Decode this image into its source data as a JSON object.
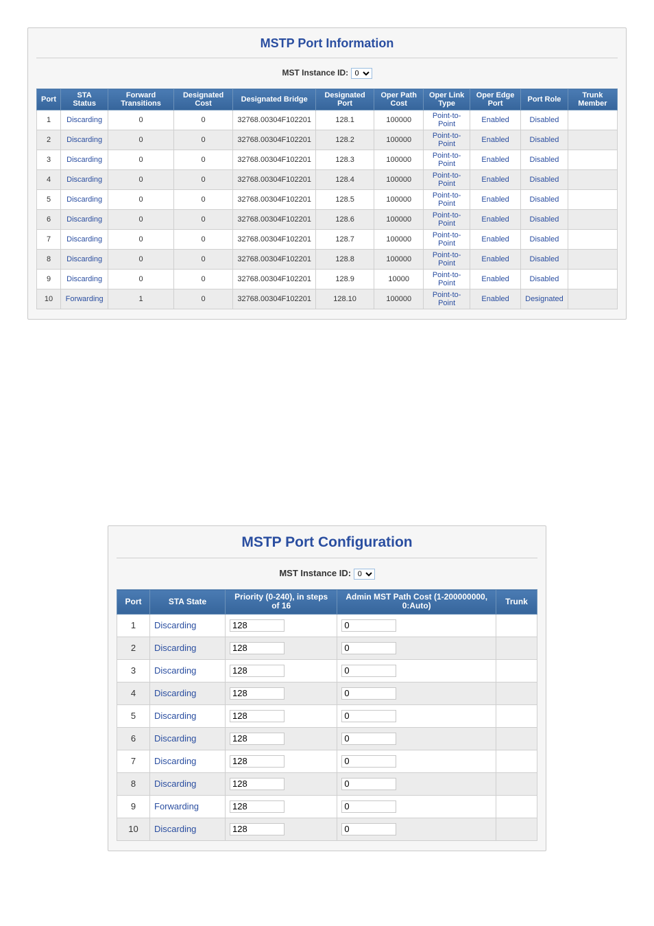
{
  "info": {
    "title": "MSTP Port Information",
    "instance_label": "MST Instance ID:",
    "instance_value": "0",
    "columns": [
      "Port",
      "STA Status",
      "Forward Transitions",
      "Designated Cost",
      "Designated Bridge",
      "Designated Port",
      "Oper Path Cost",
      "Oper Link Type",
      "Oper Edge Port",
      "Port Role",
      "Trunk Member"
    ],
    "rows": [
      {
        "port": "1",
        "sta": "Discarding",
        "ft": "0",
        "dc": "0",
        "db": "32768.00304F102201",
        "dp": "128.1",
        "opc": "100000",
        "olt": "Point-to-Point",
        "oep": "Enabled",
        "role": "Disabled",
        "tm": ""
      },
      {
        "port": "2",
        "sta": "Discarding",
        "ft": "0",
        "dc": "0",
        "db": "32768.00304F102201",
        "dp": "128.2",
        "opc": "100000",
        "olt": "Point-to-Point",
        "oep": "Enabled",
        "role": "Disabled",
        "tm": ""
      },
      {
        "port": "3",
        "sta": "Discarding",
        "ft": "0",
        "dc": "0",
        "db": "32768.00304F102201",
        "dp": "128.3",
        "opc": "100000",
        "olt": "Point-to-Point",
        "oep": "Enabled",
        "role": "Disabled",
        "tm": ""
      },
      {
        "port": "4",
        "sta": "Discarding",
        "ft": "0",
        "dc": "0",
        "db": "32768.00304F102201",
        "dp": "128.4",
        "opc": "100000",
        "olt": "Point-to-Point",
        "oep": "Enabled",
        "role": "Disabled",
        "tm": ""
      },
      {
        "port": "5",
        "sta": "Discarding",
        "ft": "0",
        "dc": "0",
        "db": "32768.00304F102201",
        "dp": "128.5",
        "opc": "100000",
        "olt": "Point-to-Point",
        "oep": "Enabled",
        "role": "Disabled",
        "tm": ""
      },
      {
        "port": "6",
        "sta": "Discarding",
        "ft": "0",
        "dc": "0",
        "db": "32768.00304F102201",
        "dp": "128.6",
        "opc": "100000",
        "olt": "Point-to-Point",
        "oep": "Enabled",
        "role": "Disabled",
        "tm": ""
      },
      {
        "port": "7",
        "sta": "Discarding",
        "ft": "0",
        "dc": "0",
        "db": "32768.00304F102201",
        "dp": "128.7",
        "opc": "100000",
        "olt": "Point-to-Point",
        "oep": "Enabled",
        "role": "Disabled",
        "tm": ""
      },
      {
        "port": "8",
        "sta": "Discarding",
        "ft": "0",
        "dc": "0",
        "db": "32768.00304F102201",
        "dp": "128.8",
        "opc": "100000",
        "olt": "Point-to-Point",
        "oep": "Enabled",
        "role": "Disabled",
        "tm": ""
      },
      {
        "port": "9",
        "sta": "Discarding",
        "ft": "0",
        "dc": "0",
        "db": "32768.00304F102201",
        "dp": "128.9",
        "opc": "10000",
        "olt": "Point-to-Point",
        "oep": "Enabled",
        "role": "Disabled",
        "tm": ""
      },
      {
        "port": "10",
        "sta": "Forwarding",
        "ft": "1",
        "dc": "0",
        "db": "32768.00304F102201",
        "dp": "128.10",
        "opc": "100000",
        "olt": "Point-to-Point",
        "oep": "Enabled",
        "role": "Designated",
        "tm": ""
      }
    ]
  },
  "config": {
    "title": "MSTP Port Configuration",
    "instance_label": "MST Instance ID:",
    "instance_value": "0",
    "columns": [
      "Port",
      "STA State",
      "Priority\n(0-240), in steps of 16",
      "Admin MST Path Cost\n(1-200000000, 0:Auto)",
      "Trunk"
    ],
    "rows": [
      {
        "port": "1",
        "state": "Discarding",
        "prio": "128",
        "cost": "0",
        "trunk": ""
      },
      {
        "port": "2",
        "state": "Discarding",
        "prio": "128",
        "cost": "0",
        "trunk": ""
      },
      {
        "port": "3",
        "state": "Discarding",
        "prio": "128",
        "cost": "0",
        "trunk": ""
      },
      {
        "port": "4",
        "state": "Discarding",
        "prio": "128",
        "cost": "0",
        "trunk": ""
      },
      {
        "port": "5",
        "state": "Discarding",
        "prio": "128",
        "cost": "0",
        "trunk": ""
      },
      {
        "port": "6",
        "state": "Discarding",
        "prio": "128",
        "cost": "0",
        "trunk": ""
      },
      {
        "port": "7",
        "state": "Discarding",
        "prio": "128",
        "cost": "0",
        "trunk": ""
      },
      {
        "port": "8",
        "state": "Discarding",
        "prio": "128",
        "cost": "0",
        "trunk": ""
      },
      {
        "port": "9",
        "state": "Forwarding",
        "prio": "128",
        "cost": "0",
        "trunk": ""
      },
      {
        "port": "10",
        "state": "Discarding",
        "prio": "128",
        "cost": "0",
        "trunk": ""
      }
    ]
  }
}
